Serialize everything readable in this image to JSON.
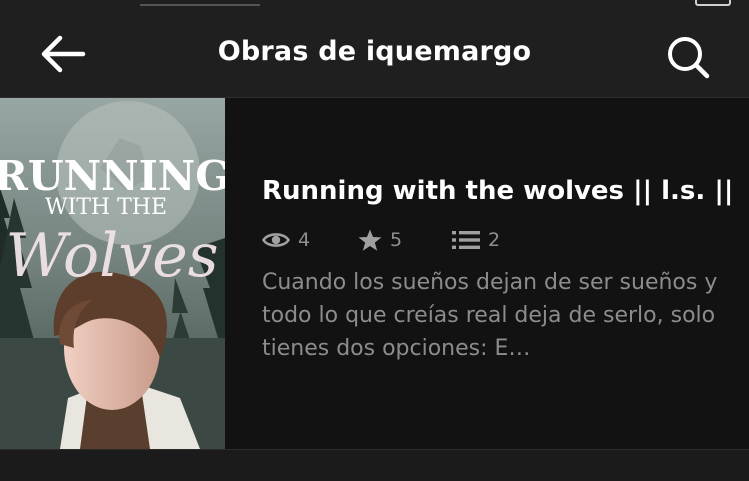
{
  "header": {
    "title": "Obras de iquemargo",
    "back_icon": "arrow-left-icon",
    "search_icon": "search-icon"
  },
  "story": {
    "title": "Running with the wolves || l.s. ||",
    "reads": "4",
    "votes": "5",
    "parts": "2",
    "description": "Cuando los sueños dejan de ser sueños y todo lo que creías real deja de serlo, solo tienes dos opciones: E…",
    "cover": {
      "line1": "RUNNING",
      "line2": "WITH THE",
      "line3": "Wolves"
    }
  },
  "colors": {
    "background": "#121212",
    "topbar": "#1f1f1f",
    "title_text": "#ffffff",
    "muted_text": "#8c8c8c"
  }
}
